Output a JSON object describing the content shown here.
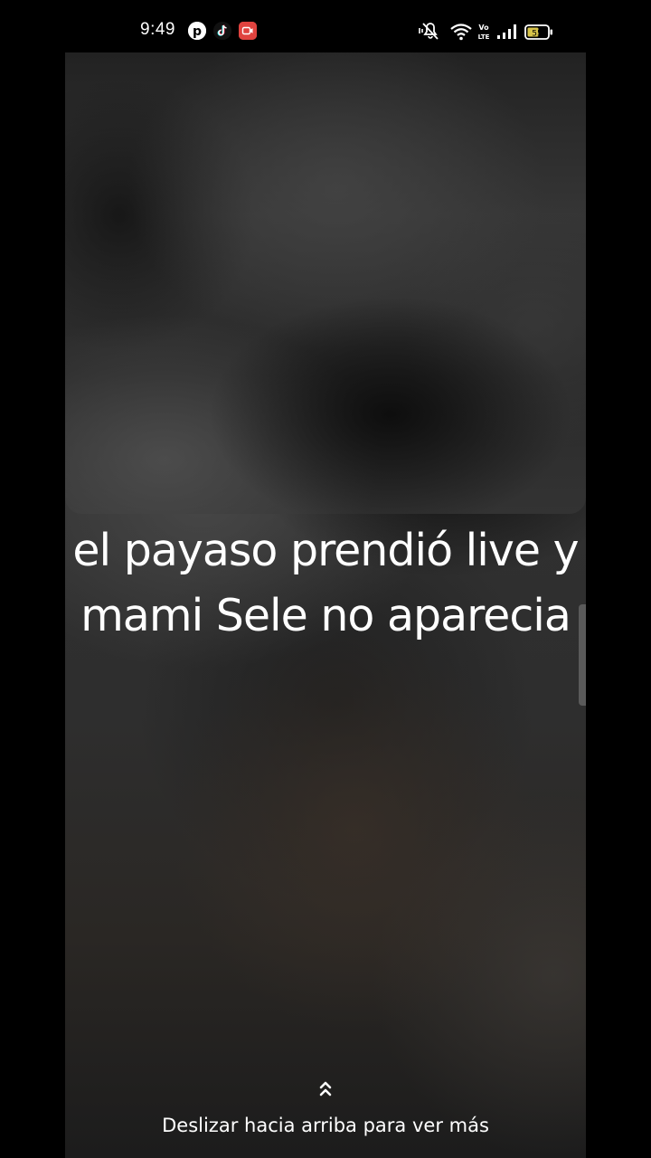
{
  "status_bar": {
    "time": "9:49",
    "battery_level": "55",
    "icons": [
      "pinterest-icon",
      "tiktok-icon",
      "screen-recorder-icon",
      "vibrate-icon",
      "wifi-icon",
      "volte-icon",
      "signal-icon",
      "battery-icon"
    ],
    "volte_label_top": "Vo",
    "volte_label_bottom": "LTE"
  },
  "caption": {
    "line1": "el payaso prendió live y",
    "line2": "mami Sele no aparecia"
  },
  "swipe_hint": {
    "label": "Deslizar hacia arriba para ver más",
    "icon": "double-chevron-up-icon"
  }
}
